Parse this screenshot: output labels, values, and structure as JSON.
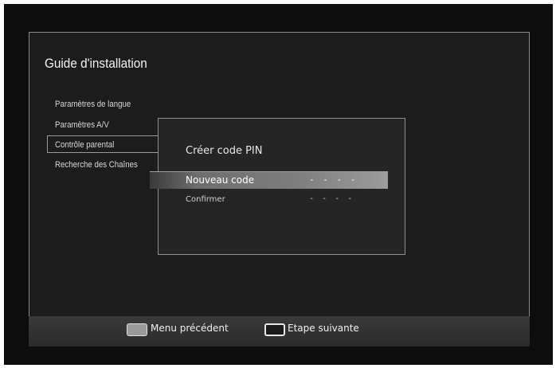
{
  "header": {
    "title": "Guide d'installation"
  },
  "sidebar": {
    "items": [
      {
        "label": "Paramètres de langue"
      },
      {
        "label": "Paramètres A/V"
      },
      {
        "label": "Contrôle parental"
      },
      {
        "label": "Recherche des Chaînes"
      }
    ],
    "selected_index": 2
  },
  "dialog": {
    "title": "Créer code PIN",
    "fields": [
      {
        "label": "Nouveau code",
        "value": "- - - -"
      },
      {
        "label": "Confirmer",
        "value": "- - - -"
      }
    ],
    "focused_index": 0
  },
  "footer": {
    "back": {
      "label": "Menu précédent",
      "key_color": "#9a9a9a"
    },
    "next": {
      "label": "Etape suivante",
      "key_color": "#1a1a1a"
    }
  }
}
